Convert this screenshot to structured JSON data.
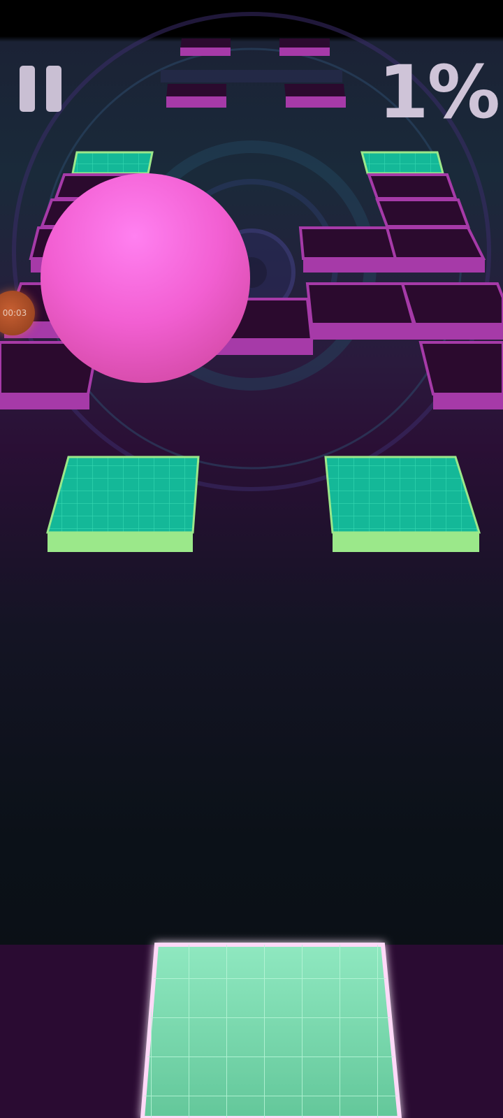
{
  "hud": {
    "progress_text": "1%",
    "timer_text": "00:03"
  },
  "icons": {
    "pause": "pause-icon"
  },
  "colors": {
    "ball": "#f25fd2",
    "tile_purple": "#2b0a2e",
    "tile_edge": "#a63aa8",
    "tile_green": "#14b898",
    "tile_green_edge": "#9be88a",
    "neon_glow": "#ff4fe0"
  }
}
